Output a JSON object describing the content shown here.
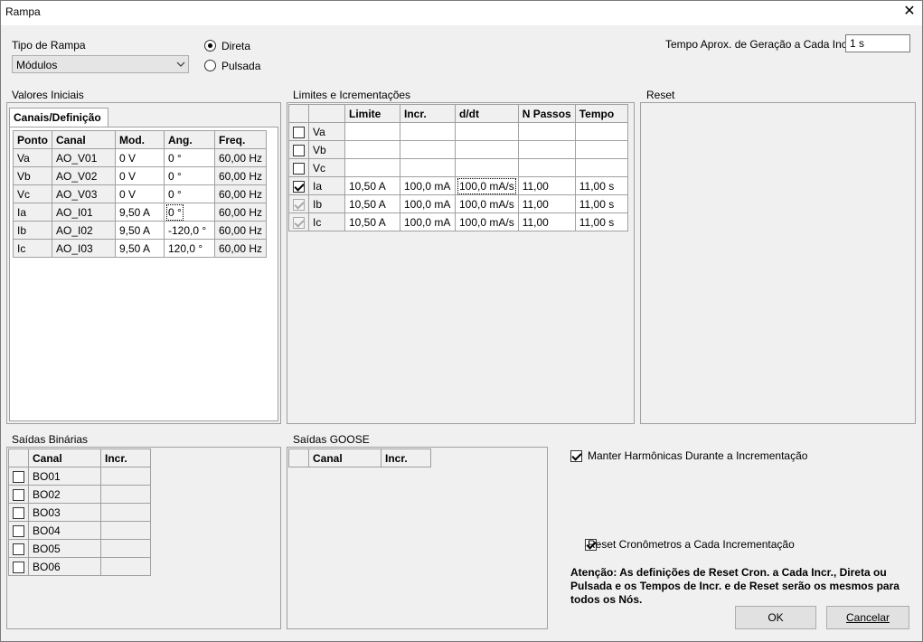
{
  "window": {
    "title": "Rampa",
    "close_glyph": "✕"
  },
  "ramp_type": {
    "label": "Tipo de Rampa",
    "value": "Módulos",
    "options": [
      {
        "label": "Direta",
        "selected": true
      },
      {
        "label": "Pulsada",
        "selected": false
      }
    ]
  },
  "gen_time": {
    "label": "Tempo Aprox. de Geração a Cada Incr.:",
    "value": "1 s"
  },
  "initial_values": {
    "label": "Valores Iniciais",
    "tab": "Canais/Definição",
    "columns": [
      "Ponto",
      "Canal",
      "Mod.",
      "Ang.",
      "Freq."
    ],
    "rows": [
      [
        "Va",
        "AO_V01",
        "0 V",
        "0 °",
        "60,00 Hz"
      ],
      [
        "Vb",
        "AO_V02",
        "0 V",
        "0 °",
        "60,00 Hz"
      ],
      [
        "Vc",
        "AO_V03",
        "0 V",
        "0 °",
        "60,00 Hz"
      ],
      [
        "Ia",
        "AO_I01",
        "9,50 A",
        "0 °",
        "60,00 Hz"
      ],
      [
        "Ib",
        "AO_I02",
        "9,50 A",
        "-120,0 °",
        "60,00 Hz"
      ],
      [
        "Ic",
        "AO_I03",
        "9,50 A",
        "120,0 °",
        "60,00 Hz"
      ]
    ]
  },
  "limits": {
    "label": "Limites e Icrementações",
    "columns": [
      "",
      "",
      "Limite",
      "Incr.",
      "d/dt",
      "N Passos",
      "Tempo"
    ],
    "rows": [
      {
        "checked": false,
        "dim": false,
        "cells": [
          "Va",
          "",
          "",
          "",
          "",
          ""
        ]
      },
      {
        "checked": false,
        "dim": false,
        "cells": [
          "Vb",
          "",
          "",
          "",
          "",
          ""
        ]
      },
      {
        "checked": false,
        "dim": false,
        "cells": [
          "Vc",
          "",
          "",
          "",
          "",
          ""
        ]
      },
      {
        "checked": true,
        "dim": false,
        "cells": [
          "Ia",
          "10,50 A",
          "100,0 mA",
          "100,0 mA/s",
          "11,00",
          "11,00 s"
        ]
      },
      {
        "checked": true,
        "dim": true,
        "cells": [
          "Ib",
          "10,50 A",
          "100,0 mA",
          "100,0 mA/s",
          "11,00",
          "11,00 s"
        ]
      },
      {
        "checked": true,
        "dim": true,
        "cells": [
          "Ic",
          "10,50 A",
          "100,0 mA",
          "100,0 mA/s",
          "11,00",
          "11,00 s"
        ]
      }
    ]
  },
  "reset": {
    "label": "Reset"
  },
  "binary_outputs": {
    "label": "Saídas Binárias",
    "columns": [
      "",
      "Canal",
      "Incr."
    ],
    "rows": [
      {
        "checked": false,
        "channel": "BO01",
        "incr": ""
      },
      {
        "checked": false,
        "channel": "BO02",
        "incr": ""
      },
      {
        "checked": false,
        "channel": "BO03",
        "incr": ""
      },
      {
        "checked": false,
        "channel": "BO04",
        "incr": ""
      },
      {
        "checked": false,
        "channel": "BO05",
        "incr": ""
      },
      {
        "checked": false,
        "channel": "BO06",
        "incr": ""
      }
    ]
  },
  "goose_outputs": {
    "label": "Saídas GOOSE",
    "columns": [
      "",
      "Canal",
      "Incr."
    ]
  },
  "options": {
    "keep_harmonics": {
      "label": "Manter Harmônicas Durante a Incrementação",
      "checked": true
    },
    "reset_timers": {
      "label": "Reset Cronômetros a Cada Incrementação",
      "checked": true
    }
  },
  "warning": "Atenção: As definições de Reset Cron. a Cada Incr., Direta ou Pulsada e os Tempos de Incr. e de Reset serão os mesmos para todos os Nós.",
  "buttons": {
    "ok": "OK",
    "cancel": "Cancelar"
  }
}
